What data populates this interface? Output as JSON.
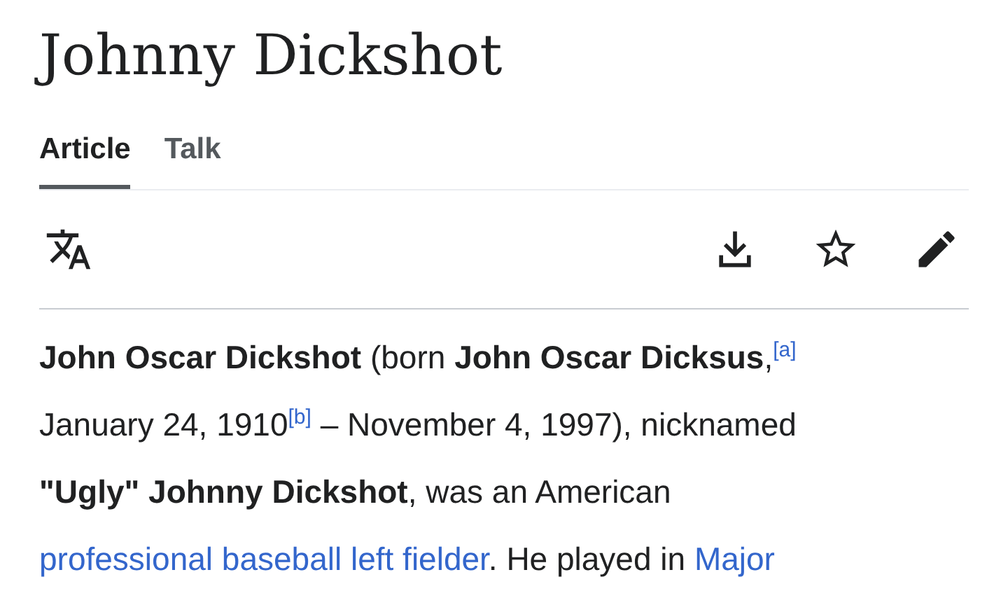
{
  "page_title": "Johnny Dickshot",
  "tabs": [
    {
      "label": "Article",
      "selected": true
    },
    {
      "label": "Talk",
      "selected": false
    }
  ],
  "paragraph_lines": [
    [
      {
        "kind": "text",
        "text": "**John Oscar Dickshot** (born **John Oscar Dicksus**,"
      },
      {
        "kind": "note",
        "text": "[a]"
      }
    ],
    [
      {
        "kind": "text",
        "text": "January 24, 1910"
      },
      {
        "kind": "note",
        "text": "[b]"
      },
      {
        "kind": "text",
        "text": " – November 4, 1997), nicknamed"
      }
    ],
    [
      {
        "kind": "text",
        "text": "**\"Ugly\" Johnny Dickshot**, was an American"
      }
    ],
    [
      {
        "kind": "link",
        "text": "professional baseball left fielder"
      },
      {
        "kind": "text",
        "text": ". He played in "
      },
      {
        "kind": "link",
        "text": "Major"
      }
    ]
  ]
}
